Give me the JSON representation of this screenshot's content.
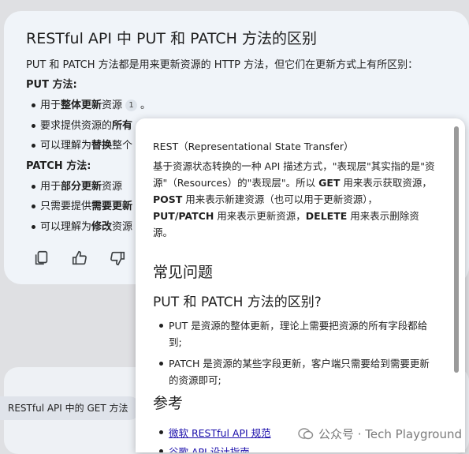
{
  "chat": {
    "title": "RESTful API 中 PUT 和 PATCH 方法的区别",
    "intro": "PUT 和 PATCH 方法都是用来更新资源的 HTTP 方法，但它们在更新方式上有所区别：",
    "put": {
      "heading": "PUT 方法:",
      "b1_pre": "用于",
      "b1_bold": "整体更新",
      "b1_post": "资源",
      "b1_cite": "1",
      "b1_end": "。",
      "b2_pre": "要求提供资源的",
      "b2_bold": "所有",
      "b3_pre": "可以理解为",
      "b3_bold": "替换",
      "b3_post": "整个"
    },
    "patch": {
      "heading": "PATCH 方法:",
      "b1_pre": "用于",
      "b1_bold": "部分更新",
      "b1_post": "资源",
      "b2_pre": "只需要提供",
      "b2_bold": "需要更新",
      "b3_pre": "可以理解为",
      "b3_bold": "修改",
      "b3_post": "资源"
    },
    "actions": [
      "copy-icon",
      "thumbs-up-icon",
      "thumbs-down-icon"
    ]
  },
  "suggestion": {
    "label": "RESTful API 中的 GET 方法"
  },
  "popup": {
    "head": "REST（Representational State Transfer）",
    "body_1": "基于资源状态转换的一种 API 描述方式，\"表现层\"其实指的是\"资源\"（Resources）的\"表现层\"。所以 ",
    "get": "GET",
    "body_2": " 用来表示获取资源，",
    "post": "POST",
    "body_3": " 用来表示新建资源（也可以用于更新资源），",
    "putpatch": "PUT/PATCH",
    "body_4": " 用来表示更新资源，",
    "delete": "DELETE",
    "body_5": " 用来表示删除资源。",
    "faq_heading": "常见问题",
    "faq_question": "PUT 和 PATCH 方法的区别?",
    "faq_item_1": "PUT 是资源的整体更新，理论上需要把资源的所有字段都给到;",
    "faq_item_2": "PATCH 是资源的某些字段更新，客户端只需要给到需要更新的资源即可;",
    "ref_heading": "参考",
    "ref_link_1": "微软 RESTful API 规范",
    "ref_link_2": "谷歌 API 设计指南"
  },
  "watermark": {
    "text": "公众号 · Tech Playground"
  }
}
